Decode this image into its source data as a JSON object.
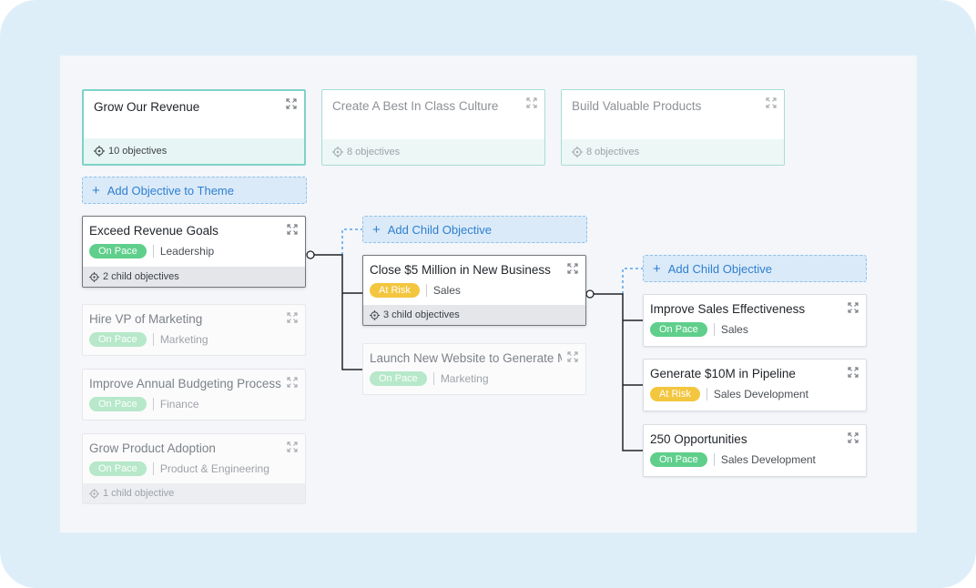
{
  "themes": [
    {
      "title": "Grow Our Revenue",
      "count": "10 objectives"
    },
    {
      "title": "Create A Best In Class Culture",
      "count": "8 objectives"
    },
    {
      "title": "Build Valuable Products",
      "count": "8 objectives"
    }
  ],
  "actions": {
    "add_objective_to_theme": "Add Objective to Theme",
    "add_child_objective": "Add Child Objective"
  },
  "column1": [
    {
      "title": "Exceed Revenue Goals",
      "status": "On Pace",
      "team": "Leadership",
      "children": "2 child objectives"
    },
    {
      "title": "Hire VP of Marketing",
      "status": "On Pace",
      "team": "Marketing"
    },
    {
      "title": "Improve Annual Budgeting Process",
      "status": "On Pace",
      "team": "Finance"
    },
    {
      "title": "Grow Product Adoption",
      "status": "On Pace",
      "team": "Product & Engineering",
      "children": "1 child objective"
    }
  ],
  "column2": [
    {
      "title": "Close $5 Million in New Business",
      "status": "At Risk",
      "team": "Sales",
      "children": "3 child objectives"
    },
    {
      "title": "Launch New Website to Generate More Leads",
      "status": "On Pace",
      "team": "Marketing"
    }
  ],
  "column3": [
    {
      "title": "Improve Sales Effectiveness",
      "status": "On Pace",
      "team": "Sales"
    },
    {
      "title": "Generate $10M in Pipeline",
      "status": "At Risk",
      "team": "Sales Development"
    },
    {
      "title": "250 Opportunities",
      "status": "On Pace",
      "team": "Sales Development"
    }
  ],
  "colors": {
    "on_pace": "#5fcf8b",
    "at_risk": "#f3c63f",
    "accent": "#2e7fd0",
    "theme_border": "#7fd2c9"
  },
  "icons": {
    "expand": "expand-icon",
    "objectives": "target-icon",
    "add": "plus-icon"
  }
}
